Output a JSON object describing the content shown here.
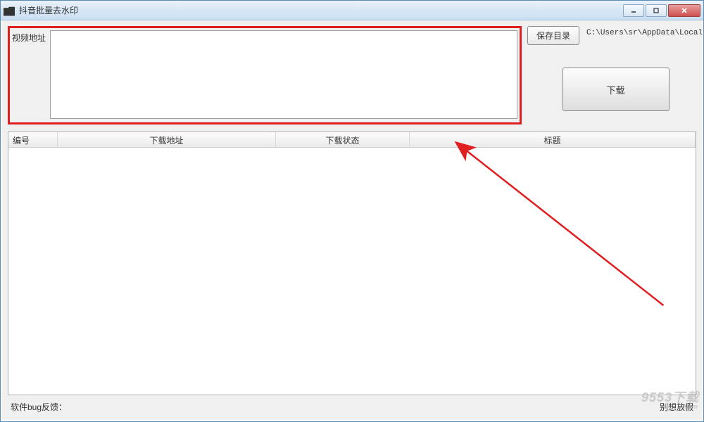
{
  "window": {
    "title": "抖音批量去水印"
  },
  "input": {
    "label": "视频地址",
    "value": ""
  },
  "buttons": {
    "save_dir": "保存目录",
    "download": "下载"
  },
  "path": "C:\\Users\\sr\\AppData\\Local",
  "table": {
    "columns": [
      "编号",
      "下载地址",
      "下载状态",
      "标题"
    ]
  },
  "footer": {
    "bug_feedback_label": "软件bug反馈：",
    "credit": "别想放假"
  },
  "watermark": {
    "main": "9553下载",
    "sub": ".com"
  }
}
